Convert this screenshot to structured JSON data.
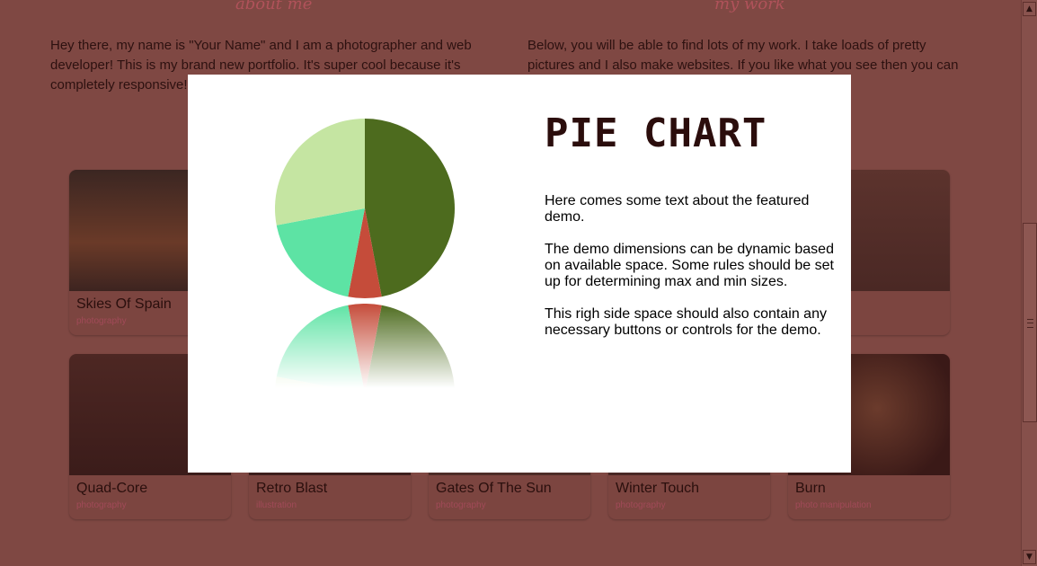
{
  "about": {
    "heading": "about me",
    "text": "Hey there, my name is \"Your Name\" and I am a photographer and web developer! This is my brand new portfolio. It's super cool because it's completely responsive! ... you like and it always l..."
  },
  "work": {
    "heading": "my work",
    "text": "Below, you will be able to find lots of my work. I take loads of pretty pictures and I also make websites. If you like what you see then you can ... or just have a chat, ..."
  },
  "cards": [
    {
      "title": "Skies Of Spain",
      "category": "photography",
      "color": "#5a2f22"
    },
    {
      "title": "",
      "category": "",
      "color": "#4a2a25"
    },
    {
      "title": "Quad-Core",
      "category": "photography",
      "color": "#4e2623"
    },
    {
      "title": "Retro Blast",
      "category": "illustration",
      "color": "#3f1f1d"
    },
    {
      "title": "Gates Of The Sun",
      "category": "photography",
      "color": "#51302a"
    },
    {
      "title": "Winter Touch",
      "category": "photography",
      "color": "#4d2a27"
    },
    {
      "title": "Burn",
      "category": "photo manipulation",
      "color": "#3a1a18"
    }
  ],
  "modal": {
    "title": "PIE CHART",
    "paragraphs": [
      "Here comes some text about the featured demo.",
      "The demo dimensions can be dynamic based on available space. Some rules should be set up for determining max and min sizes.",
      "This righ side space should also contain any necessary buttons or controls for the demo."
    ]
  },
  "chart_data": {
    "type": "pie",
    "values": [
      47,
      6,
      19,
      28
    ],
    "colors": [
      "#4d6b1e",
      "#c54c3a",
      "#5de3a4",
      "#c5e5a2"
    ]
  },
  "scrollbar": {
    "up_glyph": "▲",
    "down_glyph": "▼"
  }
}
